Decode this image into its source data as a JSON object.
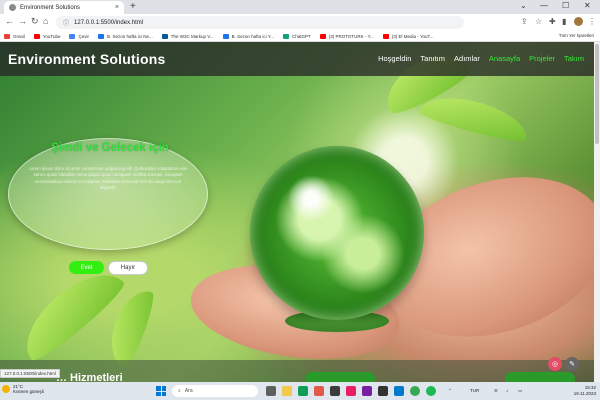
{
  "browser": {
    "tab_title": "Environment Solutions",
    "tab_close": "×",
    "new_tab": "+",
    "window_controls": [
      "⌄",
      "—",
      "☐",
      "✕"
    ],
    "nav": {
      "back": "←",
      "forward": "→",
      "reload": "↻",
      "home": "⌂"
    },
    "url": "127.0.0.1:5500/index.html",
    "bookmarks": [
      {
        "label": "Gmail",
        "color": "#ea4335"
      },
      {
        "label": "YouTube",
        "color": "#ff0000"
      },
      {
        "label": "Çevir",
        "color": "#4285f4"
      },
      {
        "label": "B. Sezon hafta ici Ne...",
        "color": "#1a73e8"
      },
      {
        "label": "The W3C Markup V...",
        "color": "#005a9c"
      },
      {
        "label": "B. Sezon hafta ici Y...",
        "color": "#1a73e8"
      },
      {
        "label": "ChatGPT",
        "color": "#10a37f"
      },
      {
        "label": "(3) PROTOTURK - Y...",
        "color": "#ff0000"
      },
      {
        "label": "(3) El Media - YouT...",
        "color": "#ff0000"
      }
    ],
    "all_bookmarks": "Tüm Yer İşaretleri"
  },
  "site": {
    "brand": "Environment Solutions",
    "nav": [
      {
        "label": "Hoşgeldin",
        "color": "#ffffff"
      },
      {
        "label": "Tanıtım",
        "color": "#ffffff"
      },
      {
        "label": "Adımlar",
        "color": "#ffffff"
      },
      {
        "label": "Anasayfa",
        "color": "#39e639"
      },
      {
        "label": "Projeler",
        "color": "#39e639"
      },
      {
        "label": "Takım",
        "color": "#39e639"
      }
    ],
    "hero": {
      "title": "Şimdi ve Gelecek için",
      "body": "Lorem ipsum dolor sit amet consectetur adipisicing elit. Quibusdam voluptatum eius earum quasi blanditiis nemo aliquid quos numquam mollitia cumque, excepturi necessitatibus dolores in voluptate molestias commodi rem illo sequi iste non eligendi.",
      "yes_label": "Evet",
      "no_label": "Hayır"
    },
    "section_title": "… Hizmetleri",
    "status_url": "127.0.0.1:5500/index.html"
  },
  "taskbar": {
    "weather_temp": "21°C",
    "weather_desc": "Kısmen güneşli",
    "search_placeholder": "Ara",
    "lang": "TUR",
    "time": "15:32",
    "date": "19.11.2023"
  },
  "colors": {
    "accent_green": "#39e639",
    "header_bg": "#282828",
    "yes_button": "#33ee11"
  }
}
